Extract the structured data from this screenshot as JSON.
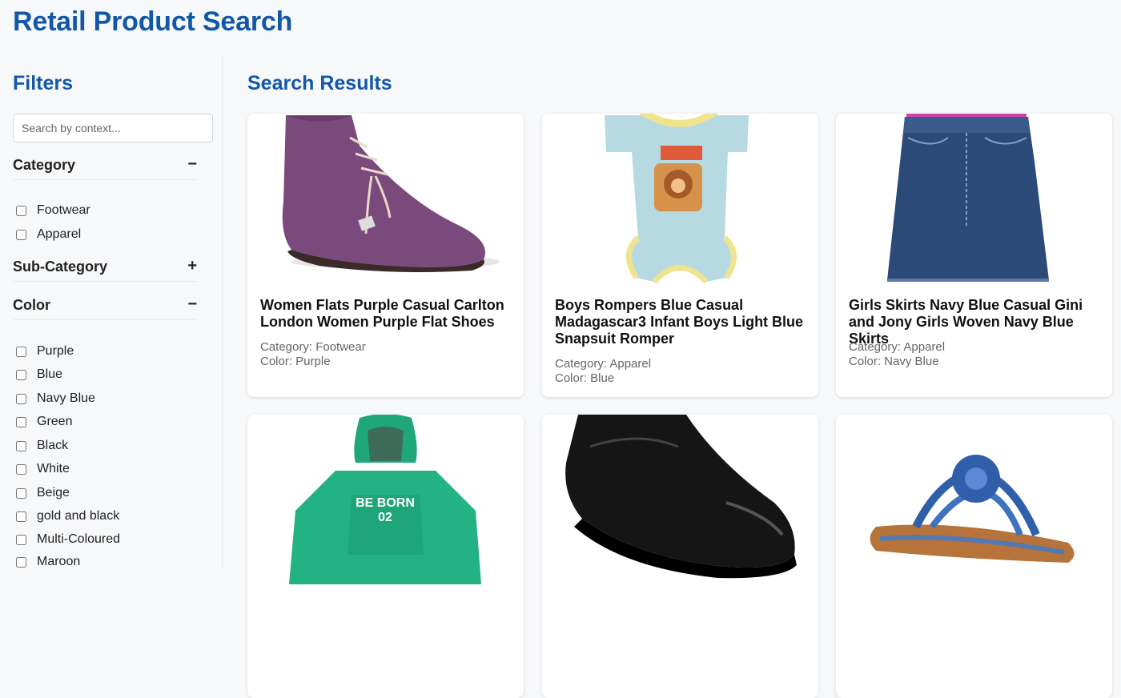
{
  "app": {
    "title": "Retail Product Search"
  },
  "sidebar": {
    "title": "Filters",
    "search_placeholder": "Search by context...",
    "sections": {
      "category": {
        "title": "Category",
        "toggle": "−",
        "options": [
          "Footwear",
          "Apparel"
        ]
      },
      "sub_category": {
        "title": "Sub-Category",
        "toggle": "+"
      },
      "color": {
        "title": "Color",
        "toggle": "−",
        "options": [
          "Purple",
          "Blue",
          "Navy Blue",
          "Green",
          "Black",
          "White",
          "Beige",
          "gold and black",
          "Multi-Coloured",
          "Maroon"
        ]
      }
    }
  },
  "results": {
    "title": "Search Results",
    "products": [
      {
        "name": "Women Flats Purple Casual Carlton London Women Purple Flat Shoes",
        "category": "Category: Footwear",
        "color": "Color: Purple",
        "image": "purple-suede-shoe"
      },
      {
        "name": "Boys Rompers Blue Casual Madagascar3 Infant Boys Light Blue Snapsuit Romper",
        "category": "Category: Apparel",
        "color": "Color: Blue",
        "image": "light-blue-romper"
      },
      {
        "name": "Girls Skirts Navy Blue Casual Gini and Jony Girls Woven Navy Blue Skirts",
        "category": "Category: Apparel",
        "color": "Color: Navy Blue",
        "image": "denim-skirt"
      },
      {
        "name": "",
        "category": "",
        "color": "",
        "image": "green-hoodie"
      },
      {
        "name": "",
        "category": "",
        "color": "",
        "image": "black-leather-shoe"
      },
      {
        "name": "",
        "category": "",
        "color": "",
        "image": "blue-flower-sandal"
      }
    ]
  },
  "colors": {
    "accent": "#1358a8"
  }
}
